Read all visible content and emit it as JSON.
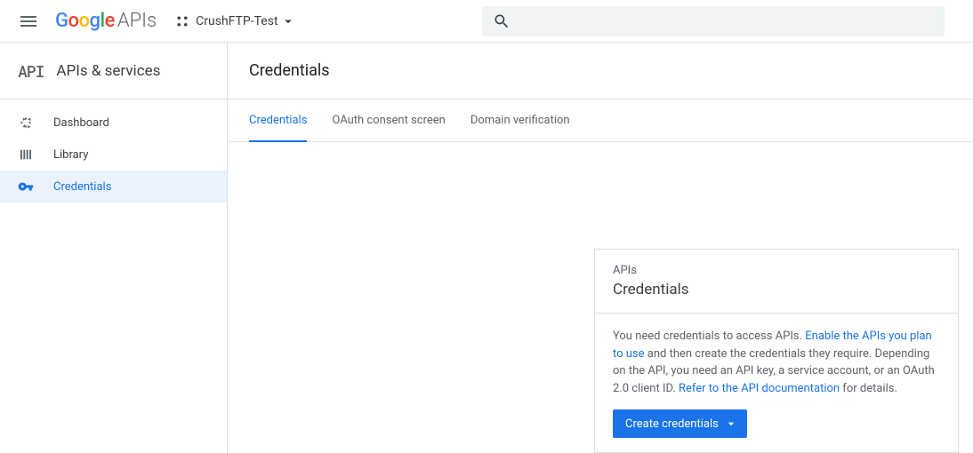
{
  "header": {
    "logo_brand": "Google",
    "logo_suffix": "APIs",
    "project_name": "CrushFTP-Test"
  },
  "sidebar": {
    "api_badge": "API",
    "title": "APIs & services",
    "items": [
      {
        "label": "Dashboard",
        "icon": "dashboard-icon",
        "active": false
      },
      {
        "label": "Library",
        "icon": "library-icon",
        "active": false
      },
      {
        "label": "Credentials",
        "icon": "key-icon",
        "active": true
      }
    ]
  },
  "main": {
    "title": "Credentials",
    "tabs": [
      {
        "label": "Credentials",
        "active": true
      },
      {
        "label": "OAuth consent screen",
        "active": false
      },
      {
        "label": "Domain verification",
        "active": false
      }
    ]
  },
  "card": {
    "supertitle": "APIs",
    "title": "Credentials",
    "text_1": "You need credentials to access APIs. ",
    "link_1": "Enable the APIs you plan to use",
    "text_2": " and then create the credentials they require. Depending on the API, you need an API key, a service account, or an OAuth 2.0 client ID. ",
    "link_2": "Refer to the API documentation",
    "text_3": " for details.",
    "button_label": "Create credentials"
  }
}
